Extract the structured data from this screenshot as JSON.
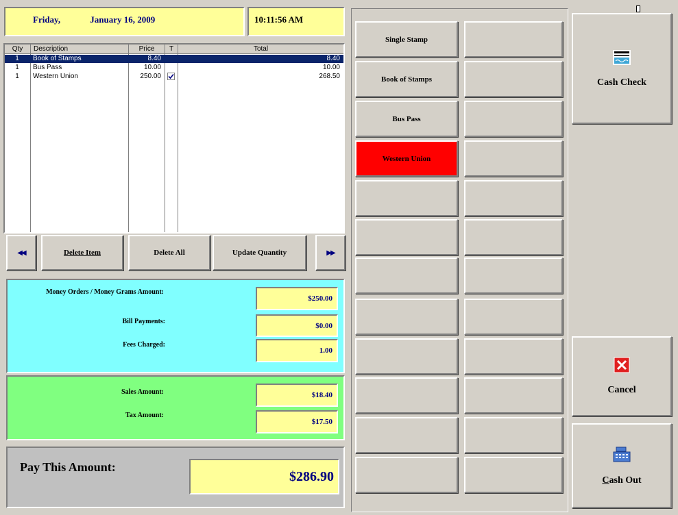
{
  "header": {
    "day": "Friday,",
    "date": "January 16, 2009",
    "time": "10:11:56 AM"
  },
  "list": {
    "columns": [
      "Qty",
      "Description",
      "Price",
      "T",
      "Total"
    ],
    "rows": [
      {
        "qty": "1",
        "description": "Book of Stamps",
        "price": "8.40",
        "taxed": false,
        "total": "8.40",
        "selected": true
      },
      {
        "qty": "1",
        "description": "Bus Pass",
        "price": "10.00",
        "taxed": false,
        "total": "10.00",
        "selected": false
      },
      {
        "qty": "1",
        "description": "Western Union",
        "price": "250.00",
        "taxed": true,
        "total": "268.50",
        "selected": false
      }
    ]
  },
  "toolbar": {
    "prev_icon": "double-left-arrow",
    "next_icon": "double-right-arrow",
    "delete_item": "Delete Item",
    "delete_all": "Delete All",
    "update_quantity": "Update Quantity"
  },
  "amounts": {
    "money_orders_label": "Money Orders / Money Grams Amount:",
    "money_orders_value": "$250.00",
    "bill_payments_label": "Bill Payments:",
    "bill_payments_value": "$0.00",
    "fees_label": "Fees Charged:",
    "fees_value": "1.00",
    "sales_label": "Sales Amount:",
    "sales_value": "$18.40",
    "tax_label": "Tax Amount:",
    "tax_value": "$17.50",
    "pay_label": "Pay This Amount:",
    "pay_value": "$286.90"
  },
  "grid": {
    "left": [
      "Single Stamp",
      "Book of Stamps",
      "Bus Pass",
      "Western Union"
    ],
    "highlight_color": "#ff0000"
  },
  "right": {
    "cash_check": "Cash Check",
    "cancel": "Cancel",
    "cash_out": "Cash Out",
    "icons": [
      "check-icon",
      "cancel-icon",
      "cash-register-icon"
    ]
  },
  "colors": {
    "cyan_panel": "#80ffff",
    "green_panel": "#80ff80",
    "value_bg": "#ffff99",
    "selection": "#0a246a"
  }
}
